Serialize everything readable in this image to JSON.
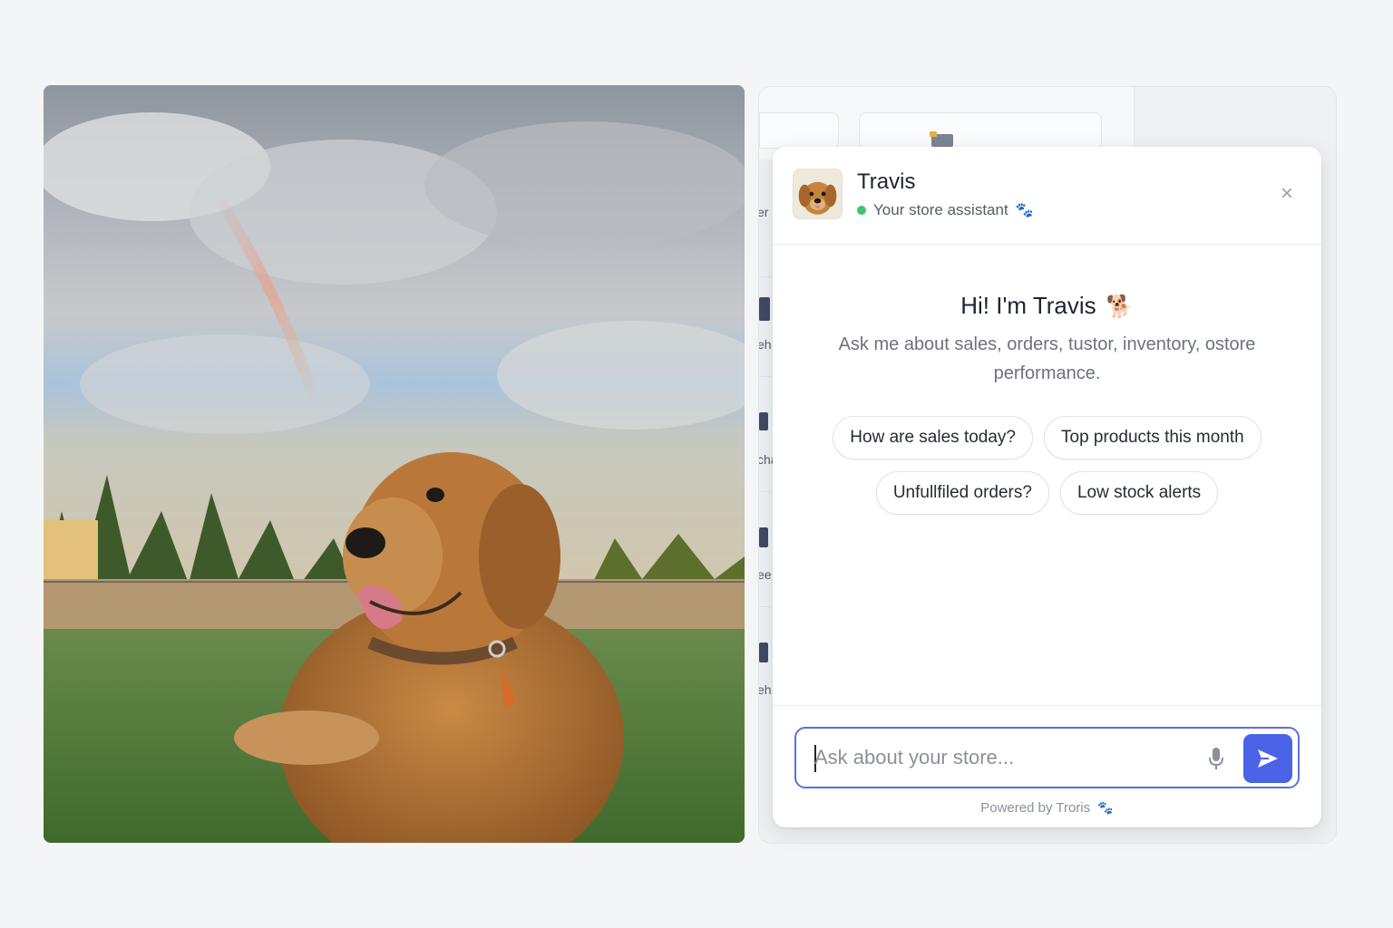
{
  "photo": {
    "alt_label": "golden retriever photo"
  },
  "background_app": {
    "sidebar_fragments": [
      "er",
      "eh",
      "cha",
      "ee",
      "eh"
    ]
  },
  "chat": {
    "agent_name": "Travis",
    "agent_status": "Your store assistant",
    "status_color": "#3ec46d",
    "greeting": "Hi! I'm Travis",
    "greeting_emoji": "🐕",
    "subtitle": "Ask me about sales, orders, tustor, inventory, ostore performance.",
    "suggestions": [
      "How are sales today?",
      "Top products this month",
      "Unfullfiled orders?",
      "Low stock alerts"
    ],
    "input_placeholder": "Ask about your store...",
    "input_value": "",
    "powered_by": "Powered by Troris",
    "accent_color": "#4a63e7",
    "close_symbol": "×",
    "paw_symbol": "🐾"
  }
}
